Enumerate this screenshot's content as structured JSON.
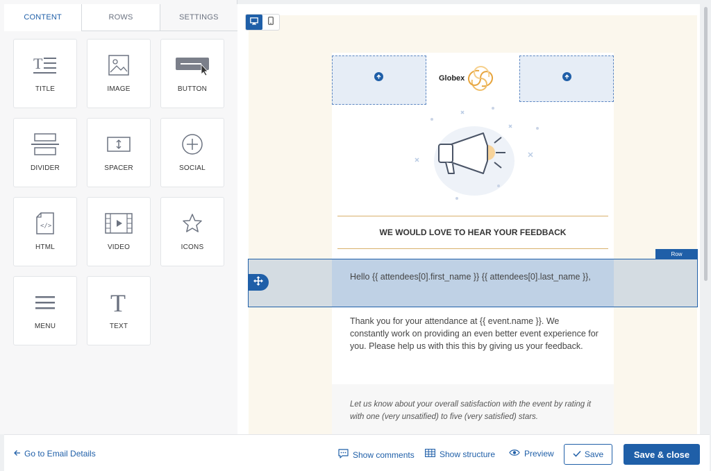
{
  "tabs": [
    {
      "label": "CONTENT",
      "active": true
    },
    {
      "label": "ROWS",
      "active": false
    },
    {
      "label": "SETTINGS",
      "active": false
    }
  ],
  "tiles": [
    {
      "label": "TITLE",
      "icon": "title-icon"
    },
    {
      "label": "IMAGE",
      "icon": "image-icon"
    },
    {
      "label": "BUTTON",
      "icon": "button-icon"
    },
    {
      "label": "DIVIDER",
      "icon": "divider-icon"
    },
    {
      "label": "SPACER",
      "icon": "spacer-icon"
    },
    {
      "label": "SOCIAL",
      "icon": "social-icon"
    },
    {
      "label": "HTML",
      "icon": "html-icon"
    },
    {
      "label": "VIDEO",
      "icon": "video-icon"
    },
    {
      "label": "ICONS",
      "icon": "star-icon"
    },
    {
      "label": "MENU",
      "icon": "menu-icon"
    },
    {
      "label": "TEXT",
      "icon": "text-icon"
    }
  ],
  "canvas": {
    "logo_text": "Globex",
    "heading": "WE WOULD LOVE TO HEAR YOUR FEEDBACK",
    "row_tag": "Row",
    "hello": "Hello {{ attendees[0].first_name }} {{ attendees[0].last_name }},",
    "thanks": "Thank you for your attendance at {{ event.name }}. We constantly work on providing an even better event experience for you. Please help us with this this by giving us your feedback.",
    "rating": "Let us know about your overall satisfaction with the event by rating it with one (very unsatified) to five (very satisfied) stars."
  },
  "footer": {
    "go_back": "Go to Email Details",
    "show_comments": "Show comments",
    "show_structure": "Show structure",
    "preview": "Preview",
    "save": "Save",
    "save_close": "Save & close"
  },
  "colors": {
    "accent": "#1f5fa8",
    "email_bg": "#fbf7ed",
    "divider_gold": "#d8b06a"
  }
}
